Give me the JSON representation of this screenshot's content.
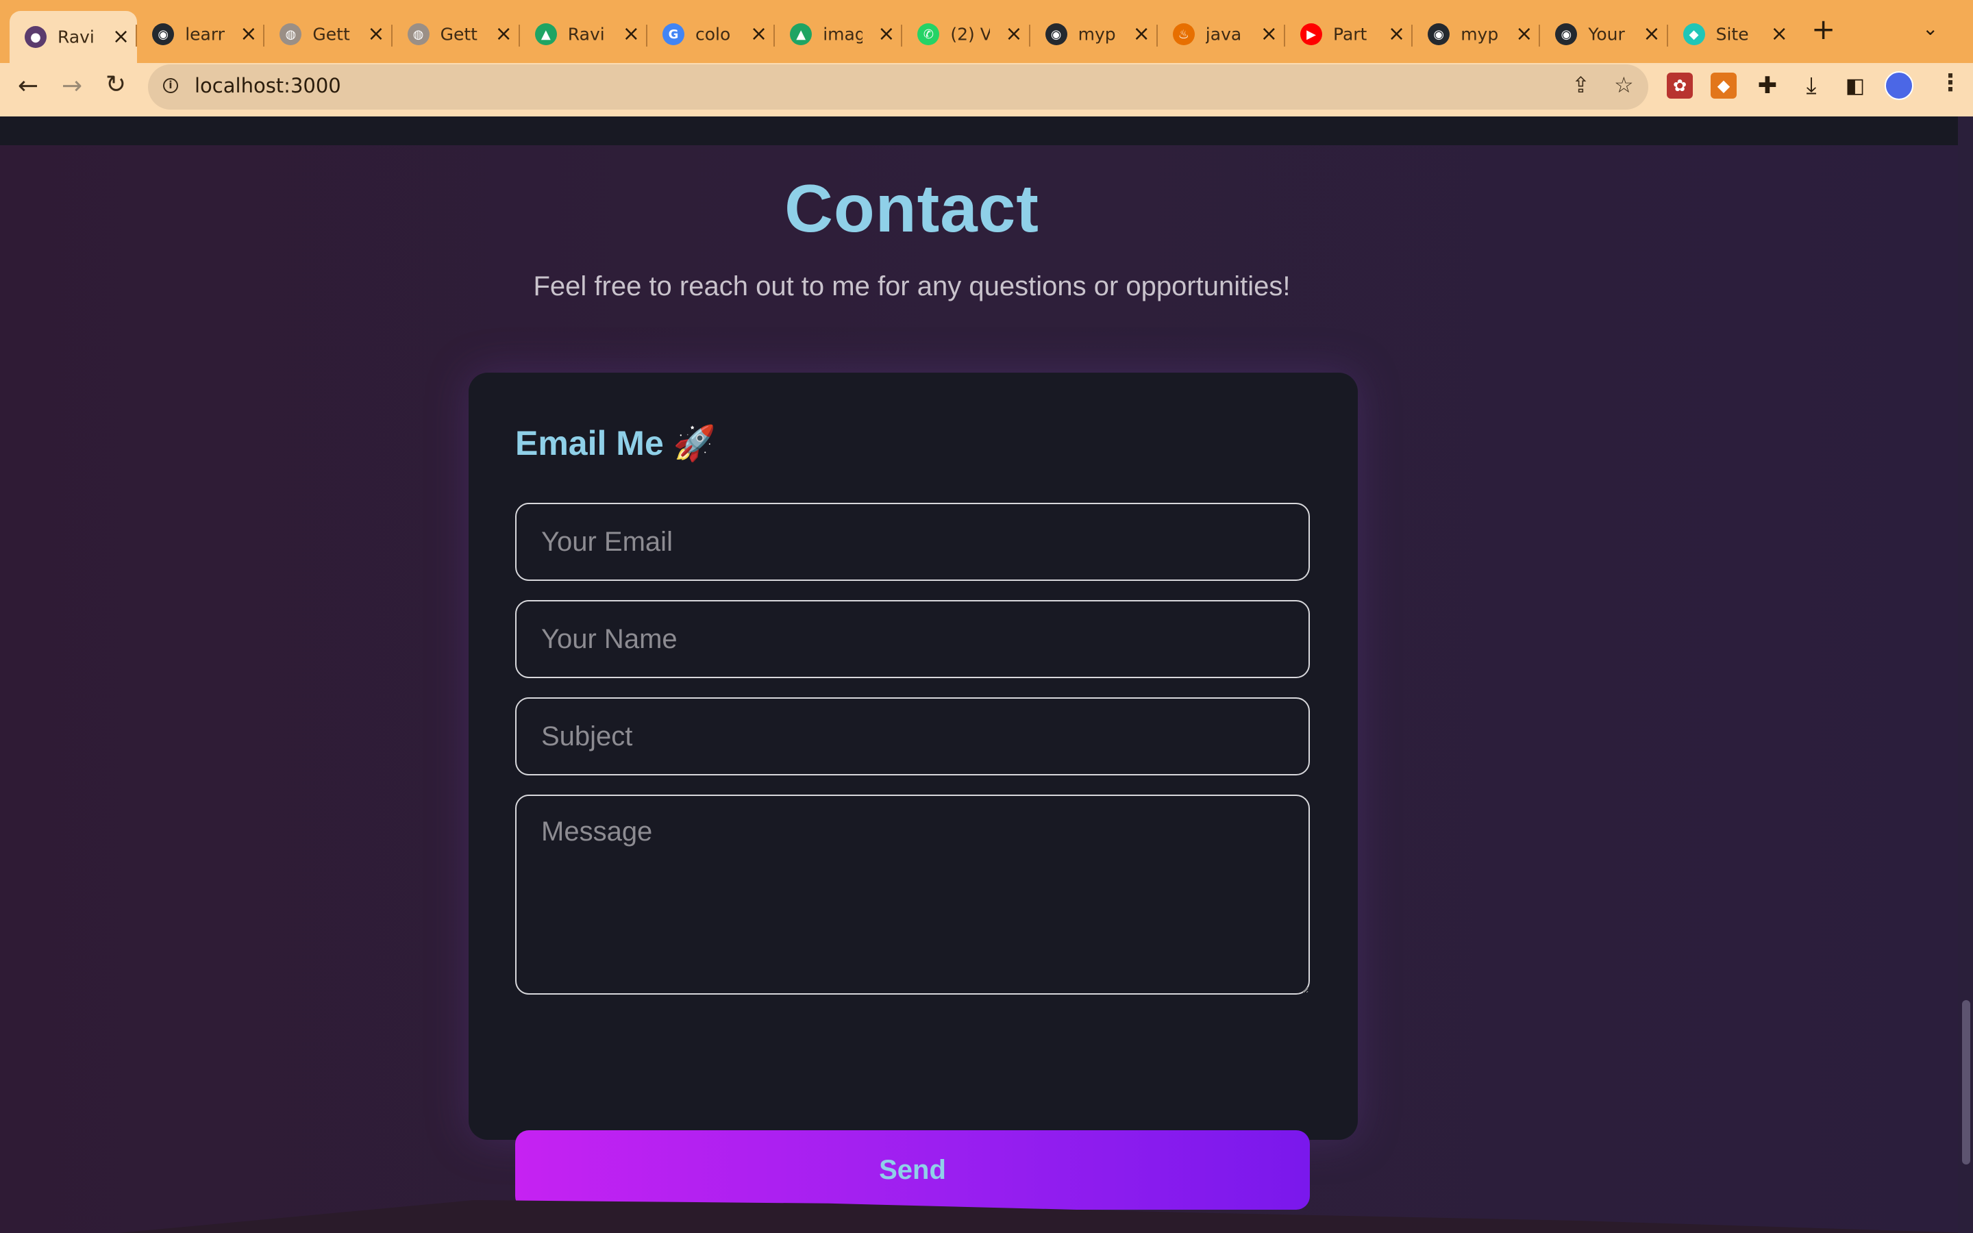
{
  "browser": {
    "tabs": [
      {
        "label": "Ravi",
        "icon": "profile-photo-icon",
        "color": "#5b3b6d"
      },
      {
        "label": "learn",
        "icon": "github-icon",
        "color": "#24292f"
      },
      {
        "label": "Gett",
        "icon": "globe-icon",
        "color": "#9a8f86"
      },
      {
        "label": "Gett",
        "icon": "globe-icon",
        "color": "#9a8f86"
      },
      {
        "label": "Ravi",
        "icon": "google-drive-icon",
        "color": "#1fa463"
      },
      {
        "label": "colo",
        "icon": "google-icon",
        "color": "#4285f4"
      },
      {
        "label": "imag",
        "icon": "google-drive-icon",
        "color": "#1fa463"
      },
      {
        "label": "(2) V",
        "icon": "whatsapp-icon",
        "color": "#25d366"
      },
      {
        "label": "myp",
        "icon": "github-icon",
        "color": "#24292f"
      },
      {
        "label": "java",
        "icon": "java-icon",
        "color": "#e76f00"
      },
      {
        "label": "Part",
        "icon": "youtube-icon",
        "color": "#ff0000"
      },
      {
        "label": "myp",
        "icon": "github-icon",
        "color": "#24292f"
      },
      {
        "label": "Your",
        "icon": "github-icon",
        "color": "#24292f"
      },
      {
        "label": "Site",
        "icon": "netlify-icon",
        "color": "#20c6b7"
      }
    ],
    "new_tab_icon": "+",
    "tab_menu_icon": "⌄",
    "url": "localhost:3000",
    "back_icon": "←",
    "forward_icon": "→",
    "reload_icon": "↻",
    "share_icon": "⇪",
    "bookmark_icon": "☆",
    "extensions": [
      "extension-icon",
      "metamask-icon",
      "puzzle-icon",
      "download-icon",
      "sidebar-icon"
    ],
    "menu_icon": "⋮"
  },
  "contact": {
    "title": "Contact",
    "subtitle": "Feel free to reach out to me for any questions or opportunities!",
    "card_heading": "Email Me 🚀",
    "email_placeholder": "Your Email",
    "name_placeholder": "Your Name",
    "subject_placeholder": "Subject",
    "message_placeholder": "Message",
    "send_label": "Send"
  },
  "colors": {
    "accent": "#8fd0e8",
    "button_gradient_start": "#c622f2",
    "button_gradient_end": "#7a18ec",
    "tabbar": "#f4ab54",
    "card_bg": "#181923"
  }
}
